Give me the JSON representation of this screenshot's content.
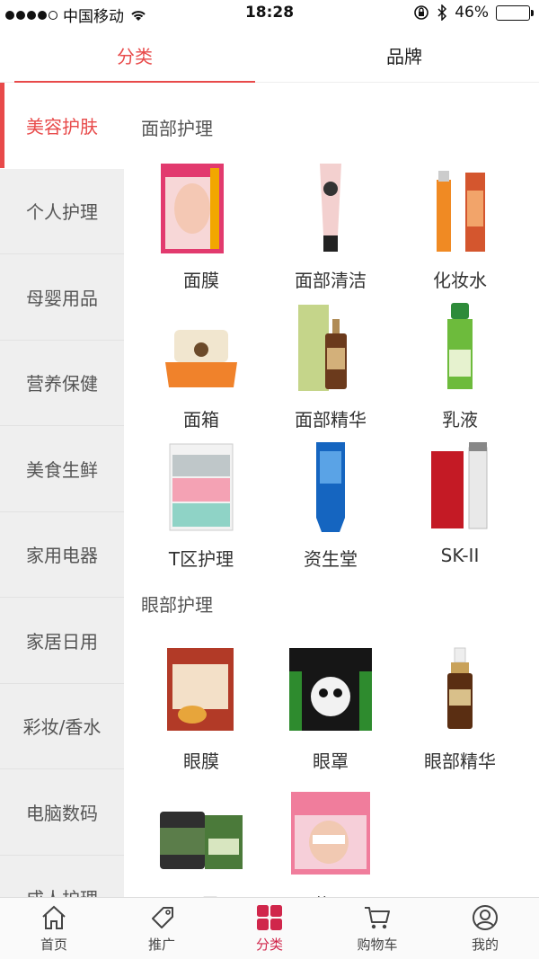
{
  "status_bar": {
    "carrier": "中国移动",
    "time": "18:28",
    "battery": "46%"
  },
  "top_tabs": [
    {
      "label": "分类"
    },
    {
      "label": "品牌"
    }
  ],
  "sidebar": {
    "items": [
      {
        "label": "美容护肤"
      },
      {
        "label": "个人护理"
      },
      {
        "label": "母婴用品"
      },
      {
        "label": "营养保健"
      },
      {
        "label": "美食生鲜"
      },
      {
        "label": "家用电器"
      },
      {
        "label": "家居日用"
      },
      {
        "label": "彩妆/香水"
      },
      {
        "label": "电脑数码"
      },
      {
        "label": "成人护理"
      }
    ]
  },
  "sections": [
    {
      "title": "面部护理",
      "products": [
        {
          "label": "面膜"
        },
        {
          "label": "面部清洁"
        },
        {
          "label": "化妆水"
        },
        {
          "label": "面箱"
        },
        {
          "label": "面部精华"
        },
        {
          "label": "乳液"
        },
        {
          "label": "T区护理"
        },
        {
          "label": "资生堂"
        },
        {
          "label": "SK-II"
        }
      ]
    },
    {
      "title": "眼部护理",
      "products": [
        {
          "label": "眼膜"
        },
        {
          "label": "眼罩"
        },
        {
          "label": "眼部精华"
        },
        {
          "label": "眼霜"
        },
        {
          "label": "花王"
        }
      ]
    }
  ],
  "bottom_nav": [
    {
      "label": "首页",
      "icon": "home-icon"
    },
    {
      "label": "推广",
      "icon": "tag-icon"
    },
    {
      "label": "分类",
      "icon": "grid-icon"
    },
    {
      "label": "购物车",
      "icon": "cart-icon"
    },
    {
      "label": "我的",
      "icon": "user-icon"
    }
  ],
  "colors": {
    "accent": "#e84a4a",
    "nav_active": "#d0264b"
  }
}
